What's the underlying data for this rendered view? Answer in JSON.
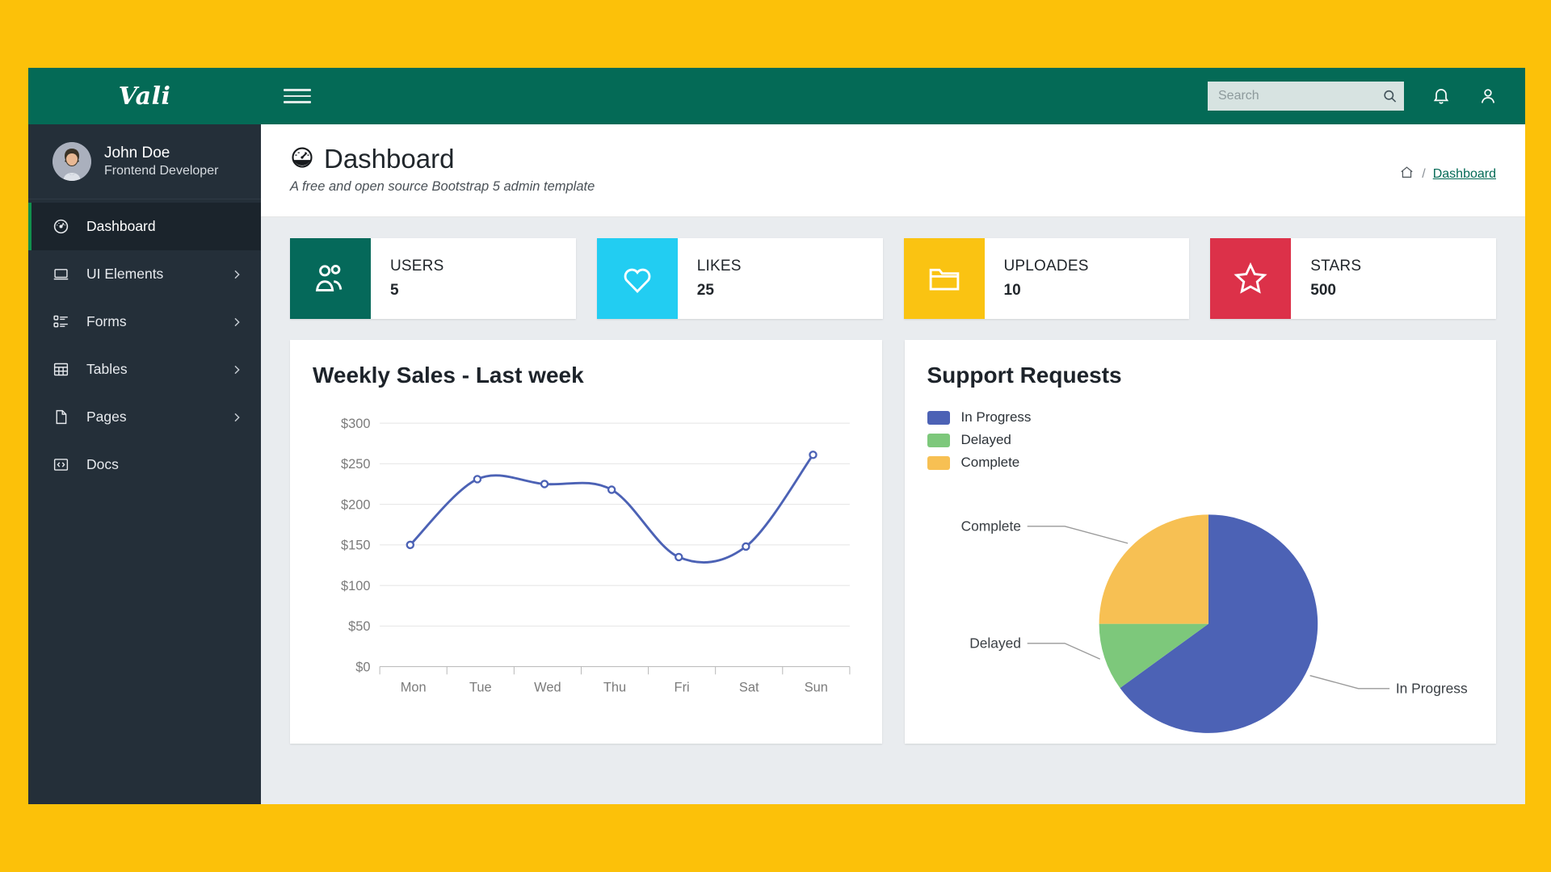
{
  "brand": {
    "name": "Vali"
  },
  "profile": {
    "name": "John Doe",
    "role": "Frontend Developer",
    "avatar_icon": "user-avatar-photo"
  },
  "sidebar": {
    "items": [
      {
        "label": "Dashboard",
        "icon": "speedometer-icon",
        "active": true,
        "chevron": false
      },
      {
        "label": "UI Elements",
        "icon": "laptop-icon",
        "active": false,
        "chevron": true
      },
      {
        "label": "Forms",
        "icon": "checklist-icon",
        "active": false,
        "chevron": true
      },
      {
        "label": "Tables",
        "icon": "table-grid-icon",
        "active": false,
        "chevron": true
      },
      {
        "label": "Pages",
        "icon": "file-icon",
        "active": false,
        "chevron": true
      },
      {
        "label": "Docs",
        "icon": "code-brackets-icon",
        "active": false,
        "chevron": false
      }
    ]
  },
  "topbar": {
    "menu_toggle_icon": "hamburger-icon",
    "search": {
      "placeholder": "Search",
      "value": "",
      "icon": "search-icon"
    },
    "notifications_icon": "bell-icon",
    "account_icon": "user-icon"
  },
  "page": {
    "title": "Dashboard",
    "title_icon": "speedometer-icon",
    "subtitle": "A free and open source Bootstrap 5 admin template",
    "breadcrumb": {
      "home_icon": "home-icon",
      "separator": "/",
      "current": "Dashboard"
    }
  },
  "stats": [
    {
      "label": "USERS",
      "value": "5",
      "icon": "people-icon",
      "color": "#05695A"
    },
    {
      "label": "LIKES",
      "value": "25",
      "icon": "heart-icon",
      "color": "#22CDF2"
    },
    {
      "label": "UPLOADES",
      "value": "10",
      "icon": "folder-icon",
      "color": "#FAC312"
    },
    {
      "label": "STARS",
      "value": "500",
      "icon": "star-icon",
      "color": "#DC3149"
    }
  ],
  "panels": {
    "sales_title": "Weekly Sales - Last week",
    "support_title": "Support Requests"
  },
  "chart_data": [
    {
      "type": "line",
      "title": "Weekly Sales - Last week",
      "categories": [
        "Mon",
        "Tue",
        "Wed",
        "Thu",
        "Fri",
        "Sat",
        "Sun"
      ],
      "values": [
        150,
        231,
        225,
        218,
        135,
        148,
        261
      ],
      "ytick_labels": [
        "$0",
        "$50",
        "$100",
        "$150",
        "$200",
        "$250",
        "$300"
      ],
      "yticks": [
        0,
        50,
        100,
        150,
        200,
        250,
        300
      ],
      "ylim": [
        0,
        300
      ],
      "xlabel": "",
      "ylabel": "",
      "grid": true,
      "legend": false,
      "line_color": "#4C62B5",
      "marker": "circle-open"
    },
    {
      "type": "pie",
      "title": "Support Requests",
      "labels": [
        "In Progress",
        "Delayed",
        "Complete"
      ],
      "values": [
        65,
        10,
        25
      ],
      "colors": [
        "#4C62B5",
        "#7DC87B",
        "#F7C053"
      ],
      "legend_position": "top-left",
      "annotations": [
        "In Progress",
        "Delayed",
        "Complete"
      ]
    }
  ]
}
